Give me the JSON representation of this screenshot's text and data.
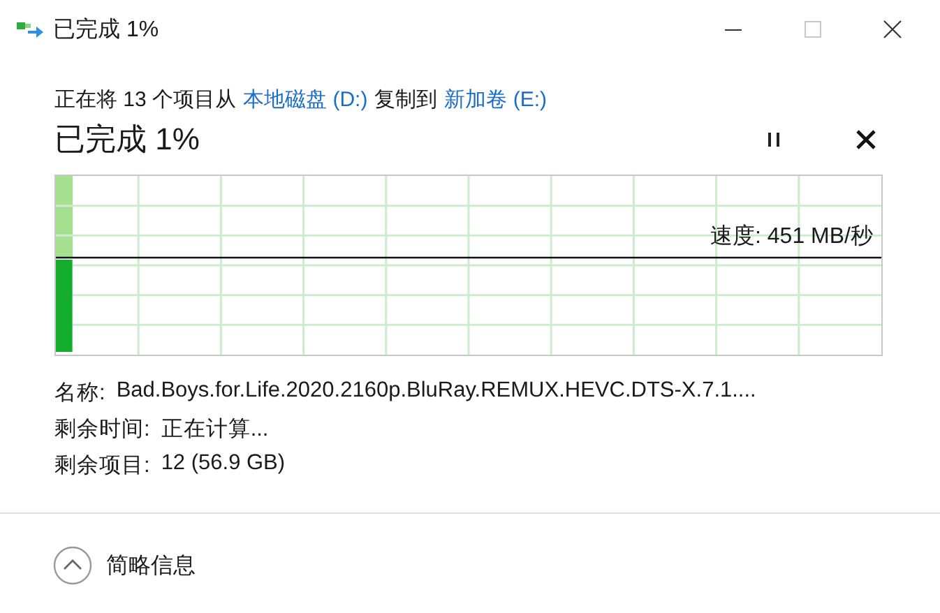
{
  "window": {
    "title": "已完成 1%"
  },
  "summary": {
    "prefix": "正在将 13 个项目从",
    "source": "本地磁盘 (D:)",
    "middle": "复制到",
    "destination": "新加卷 (E:)"
  },
  "heading": "已完成 1%",
  "progress": {
    "level": 0.02,
    "speed": "速度: 451 MB/秒"
  },
  "details": [
    {
      "label": "名称:",
      "value": "Bad.Boys.for.Life.2020.2160p.BluRay.REMUX.HEVC.DTS-X.7.1...."
    },
    {
      "label": "剩余时间:",
      "value": "正在计算..."
    },
    {
      "label": "剩余项目:",
      "value": "12 (56.9 GB)"
    }
  ],
  "footer": {
    "label": "简略信息"
  }
}
